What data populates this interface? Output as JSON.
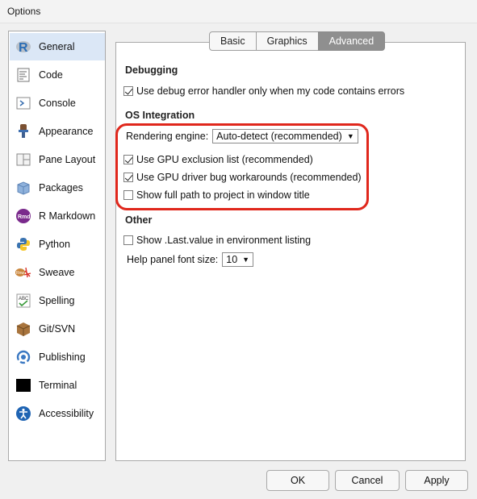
{
  "window": {
    "title": "Options"
  },
  "sidebar": {
    "items": [
      {
        "label": "General",
        "icon": "r-logo-icon"
      },
      {
        "label": "Code",
        "icon": "code-icon"
      },
      {
        "label": "Console",
        "icon": "console-icon"
      },
      {
        "label": "Appearance",
        "icon": "appearance-icon"
      },
      {
        "label": "Pane Layout",
        "icon": "pane-layout-icon"
      },
      {
        "label": "Packages",
        "icon": "packages-icon"
      },
      {
        "label": "R Markdown",
        "icon": "rmarkdown-icon"
      },
      {
        "label": "Python",
        "icon": "python-icon"
      },
      {
        "label": "Sweave",
        "icon": "sweave-icon"
      },
      {
        "label": "Spelling",
        "icon": "spelling-icon"
      },
      {
        "label": "Git/SVN",
        "icon": "git-icon"
      },
      {
        "label": "Publishing",
        "icon": "publishing-icon"
      },
      {
        "label": "Terminal",
        "icon": "terminal-icon"
      },
      {
        "label": "Accessibility",
        "icon": "accessibility-icon"
      }
    ],
    "selected": "General"
  },
  "tabs": [
    {
      "label": "Basic"
    },
    {
      "label": "Graphics"
    },
    {
      "label": "Advanced"
    }
  ],
  "active_tab": "Advanced",
  "debugging": {
    "heading": "Debugging",
    "debug_handler": {
      "label": "Use debug error handler only when my code contains errors",
      "checked": true
    }
  },
  "os_integration": {
    "heading": "OS Integration",
    "rendering_label": "Rendering engine:",
    "rendering_value": "Auto-detect (recommended)",
    "gpu_exclusion": {
      "label": "Use GPU exclusion list (recommended)",
      "checked": true
    },
    "gpu_workarounds": {
      "label": "Use GPU driver bug workarounds (recommended)",
      "checked": true
    },
    "full_path": {
      "label": "Show full path to project in window title",
      "checked": false
    }
  },
  "other": {
    "heading": "Other",
    "last_value": {
      "label": "Show .Last.value in environment listing",
      "checked": false
    },
    "font_size_label": "Help panel font size:",
    "font_size_value": "10"
  },
  "buttons": {
    "ok": "OK",
    "cancel": "Cancel",
    "apply": "Apply"
  },
  "colors": {
    "highlight": "#e0271c",
    "selected_bg": "#dbe7f6",
    "active_tab": "#8f8f8f"
  }
}
